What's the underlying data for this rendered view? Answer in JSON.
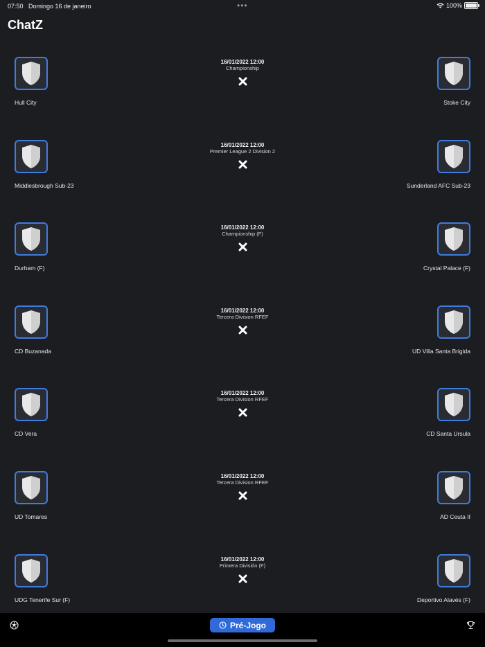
{
  "status_bar": {
    "time": "07:50",
    "date": "Domingo 16 de janeiro",
    "battery": "100%"
  },
  "app": {
    "title": "ChatZ"
  },
  "matches": [
    {
      "datetime": "16/01/2022 12:00",
      "league": "Championship",
      "home": "Hull City",
      "away": "Stoke City"
    },
    {
      "datetime": "16/01/2022 12:00",
      "league": "Premier League 2 Division 2",
      "home": "Middlesbrough Sub-23",
      "away": "Sunderland AFC Sub-23"
    },
    {
      "datetime": "16/01/2022 12:00",
      "league": "Championship (F)",
      "home": "Durham (F)",
      "away": "Crystal Palace (F)"
    },
    {
      "datetime": "16/01/2022 12:00",
      "league": "Tercera Division RFEF",
      "home": "CD Buzanada",
      "away": "UD Villa Santa Brigida"
    },
    {
      "datetime": "16/01/2022 12:00",
      "league": "Tercera Division RFEF",
      "home": "CD Vera",
      "away": "CD Santa Ursula"
    },
    {
      "datetime": "16/01/2022 12:00",
      "league": "Tercera Division RFEF",
      "home": "UD Tomares",
      "away": "AD Ceuta II"
    },
    {
      "datetime": "16/01/2022 12:00",
      "league": "Primera División (F)",
      "home": "UDG Tenerife Sur (F)",
      "away": "Deportivo Alavés (F)"
    }
  ],
  "tab_bar": {
    "active_label": "Pré-Jogo",
    "left_icon": "soccer-ball-icon",
    "right_icon": "trophy-icon",
    "accent": "#2f6ad8"
  }
}
